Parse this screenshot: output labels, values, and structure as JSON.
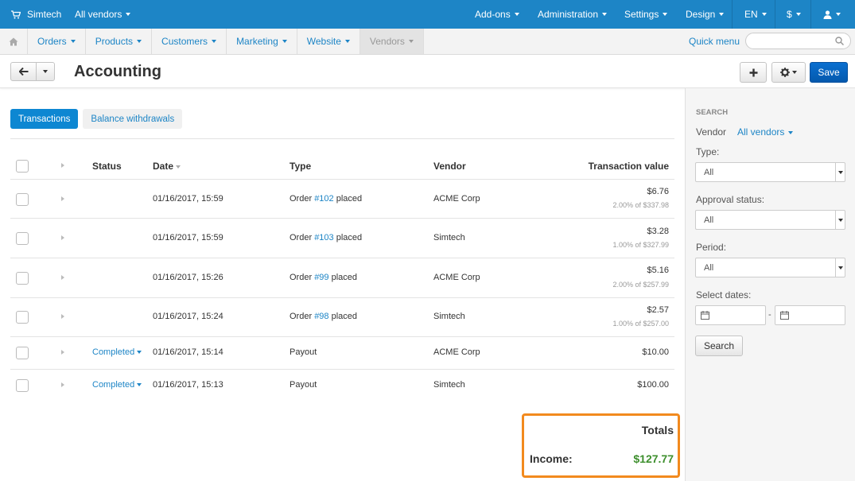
{
  "topbar": {
    "store_name": "Simtech",
    "vendor_selector": "All vendors",
    "menu": [
      "Add-ons",
      "Administration",
      "Settings",
      "Design",
      "EN",
      "$"
    ]
  },
  "navbar": {
    "items": [
      "Orders",
      "Products",
      "Customers",
      "Marketing",
      "Website",
      "Vendors"
    ],
    "quick_menu": "Quick menu",
    "search_placeholder": ""
  },
  "page": {
    "title": "Accounting",
    "save_label": "Save"
  },
  "tabs": [
    "Transactions",
    "Balance withdrawals"
  ],
  "table": {
    "headers": {
      "status": "Status",
      "date": "Date",
      "type": "Type",
      "vendor": "Vendor",
      "value": "Transaction value"
    },
    "rows": [
      {
        "status": "",
        "date": "01/16/2017, 15:59",
        "type_prefix": "Order ",
        "order": "#102",
        "type_suffix": " placed",
        "vendor": "ACME Corp",
        "value": "$6.76",
        "detail": "2.00% of $337.98"
      },
      {
        "status": "",
        "date": "01/16/2017, 15:59",
        "type_prefix": "Order ",
        "order": "#103",
        "type_suffix": " placed",
        "vendor": "Simtech",
        "value": "$3.28",
        "detail": "1.00% of $327.99"
      },
      {
        "status": "",
        "date": "01/16/2017, 15:26",
        "type_prefix": "Order ",
        "order": "#99",
        "type_suffix": " placed",
        "vendor": "ACME Corp",
        "value": "$5.16",
        "detail": "2.00% of $257.99"
      },
      {
        "status": "",
        "date": "01/16/2017, 15:24",
        "type_prefix": "Order ",
        "order": "#98",
        "type_suffix": " placed",
        "vendor": "Simtech",
        "value": "$2.57",
        "detail": "1.00% of $257.00"
      },
      {
        "status": "Completed",
        "date": "01/16/2017, 15:14",
        "type_prefix": "Payout",
        "order": "",
        "type_suffix": "",
        "vendor": "ACME Corp",
        "value": "$10.00",
        "detail": ""
      },
      {
        "status": "Completed",
        "date": "01/16/2017, 15:13",
        "type_prefix": "Payout",
        "order": "",
        "type_suffix": "",
        "vendor": "Simtech",
        "value": "$100.00",
        "detail": ""
      }
    ]
  },
  "totals": {
    "title": "Totals",
    "income_label": "Income:",
    "income_value": "$127.77"
  },
  "sidebar": {
    "heading": "SEARCH",
    "vendor_label": "Vendor",
    "vendor_value": "All vendors",
    "type_label": "Type:",
    "type_value": "All",
    "approval_label": "Approval status:",
    "approval_value": "All",
    "period_label": "Period:",
    "period_value": "All",
    "dates_label": "Select dates:",
    "dates_separator": "-",
    "search_button": "Search"
  },
  "colors": {
    "brand_blue": "#1d85c6",
    "save_blue": "#0459ad",
    "highlight": "#f28a1e",
    "income_green": "#3d8f2d"
  }
}
